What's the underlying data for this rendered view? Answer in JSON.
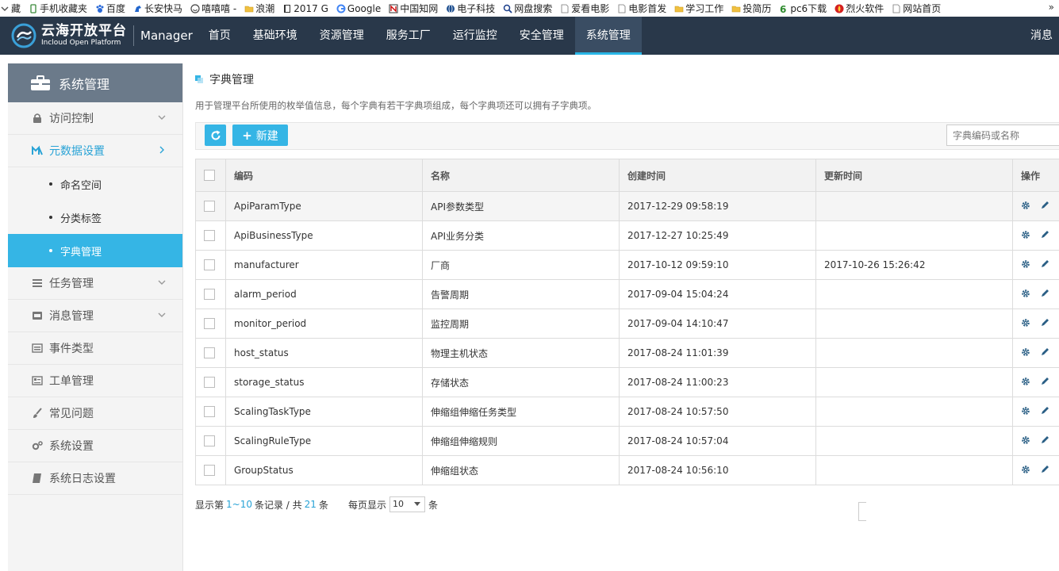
{
  "bookmarks": [
    {
      "label": "藏",
      "icon": "chevron-down-icon"
    },
    {
      "label": "手机收藏夹",
      "icon": "phone-icon"
    },
    {
      "label": "百度",
      "icon": "baidu-paw-icon"
    },
    {
      "label": "长安快马",
      "icon": "horse-icon"
    },
    {
      "label": "嘻嘻嘻 -",
      "icon": "smile-icon"
    },
    {
      "label": "浪潮",
      "icon": "folder-icon"
    },
    {
      "label": "2017 G",
      "icon": "book-icon"
    },
    {
      "label": "Google",
      "icon": "google-g-icon"
    },
    {
      "label": "中国知网",
      "icon": "cnki-icon"
    },
    {
      "label": "电子科技",
      "icon": "globe-icon"
    },
    {
      "label": "网盘搜索",
      "icon": "search-cloud-icon"
    },
    {
      "label": "爱看电影",
      "icon": "page-icon"
    },
    {
      "label": "电影首发",
      "icon": "page-icon"
    },
    {
      "label": "学习工作",
      "icon": "folder-icon"
    },
    {
      "label": "投简历",
      "icon": "folder-icon"
    },
    {
      "label": "pc6下载",
      "icon": "pc6-icon"
    },
    {
      "label": "烈火软件",
      "icon": "fire-icon"
    },
    {
      "label": "网站首页",
      "icon": "page-icon"
    }
  ],
  "bookmarks_more": "»",
  "brand": {
    "cn": "云海开放平台",
    "en": "Incloud Open Platform",
    "manager": "Manager"
  },
  "topnav": {
    "items": [
      "首页",
      "基础环境",
      "资源管理",
      "服务工厂",
      "运行监控",
      "安全管理",
      "系统管理"
    ],
    "active_index": 6,
    "right": "消息"
  },
  "sidebar": {
    "header": "系统管理",
    "items": [
      {
        "label": "访问控制",
        "icon": "lock-icon",
        "chevron": "down"
      },
      {
        "label": "元数据设置",
        "icon": "metadata-icon",
        "chevron": "right",
        "expanded": true,
        "children": [
          "命名空间",
          "分类标签",
          "字典管理"
        ],
        "active_child": 2
      },
      {
        "label": "任务管理",
        "icon": "task-list-icon",
        "chevron": "down"
      },
      {
        "label": "消息管理",
        "icon": "message-icon",
        "chevron": "down"
      },
      {
        "label": "事件类型",
        "icon": "event-icon"
      },
      {
        "label": "工单管理",
        "icon": "ticket-icon"
      },
      {
        "label": "常见问题",
        "icon": "brush-icon"
      },
      {
        "label": "系统设置",
        "icon": "gears-icon"
      },
      {
        "label": "系统日志设置",
        "icon": "log-book-icon"
      }
    ]
  },
  "page": {
    "title": "字典管理",
    "description": "用于管理平台所使用的枚举值信息，每个字典有若干字典项组成，每个字典项还可以拥有子字典项。",
    "new_button": "新建",
    "search_placeholder": "字典编码或名称"
  },
  "table": {
    "columns": [
      "编码",
      "名称",
      "创建时间",
      "更新时间",
      "操作"
    ],
    "rows": [
      {
        "code": "ApiParamType",
        "name": "API参数类型",
        "created": "2017-12-29 09:58:19",
        "updated": ""
      },
      {
        "code": "ApiBusinessType",
        "name": "API业务分类",
        "created": "2017-12-27 10:25:49",
        "updated": ""
      },
      {
        "code": "manufacturer",
        "name": "厂商",
        "created": "2017-10-12 09:59:10",
        "updated": "2017-10-26 15:26:42"
      },
      {
        "code": "alarm_period",
        "name": "告警周期",
        "created": "2017-09-04 15:04:24",
        "updated": ""
      },
      {
        "code": "monitor_period",
        "name": "监控周期",
        "created": "2017-09-04 14:10:47",
        "updated": ""
      },
      {
        "code": "host_status",
        "name": "物理主机状态",
        "created": "2017-08-24 11:01:39",
        "updated": ""
      },
      {
        "code": "storage_status",
        "name": "存储状态",
        "created": "2017-08-24 11:00:23",
        "updated": ""
      },
      {
        "code": "ScalingTaskType",
        "name": "伸缩组伸缩任务类型",
        "created": "2017-08-24 10:57:50",
        "updated": ""
      },
      {
        "code": "ScalingRuleType",
        "name": "伸缩组伸缩规则",
        "created": "2017-08-24 10:57:04",
        "updated": ""
      },
      {
        "code": "GroupStatus",
        "name": "伸缩组状态",
        "created": "2017-08-24 10:56:10",
        "updated": ""
      }
    ],
    "highlight_row": 0
  },
  "footer": {
    "prefix": "显示第",
    "range": "1~10",
    "middle": "条记录 / 共",
    "total": "21",
    "suffix": "条",
    "per_page_label": "每页显示",
    "per_page": "10",
    "per_page_unit": "条"
  },
  "colors": {
    "nav_bg": "#29384a",
    "accent": "#35b5e5",
    "sidebar_head": "#6b7a8a",
    "link_blue": "#29a3d6"
  }
}
